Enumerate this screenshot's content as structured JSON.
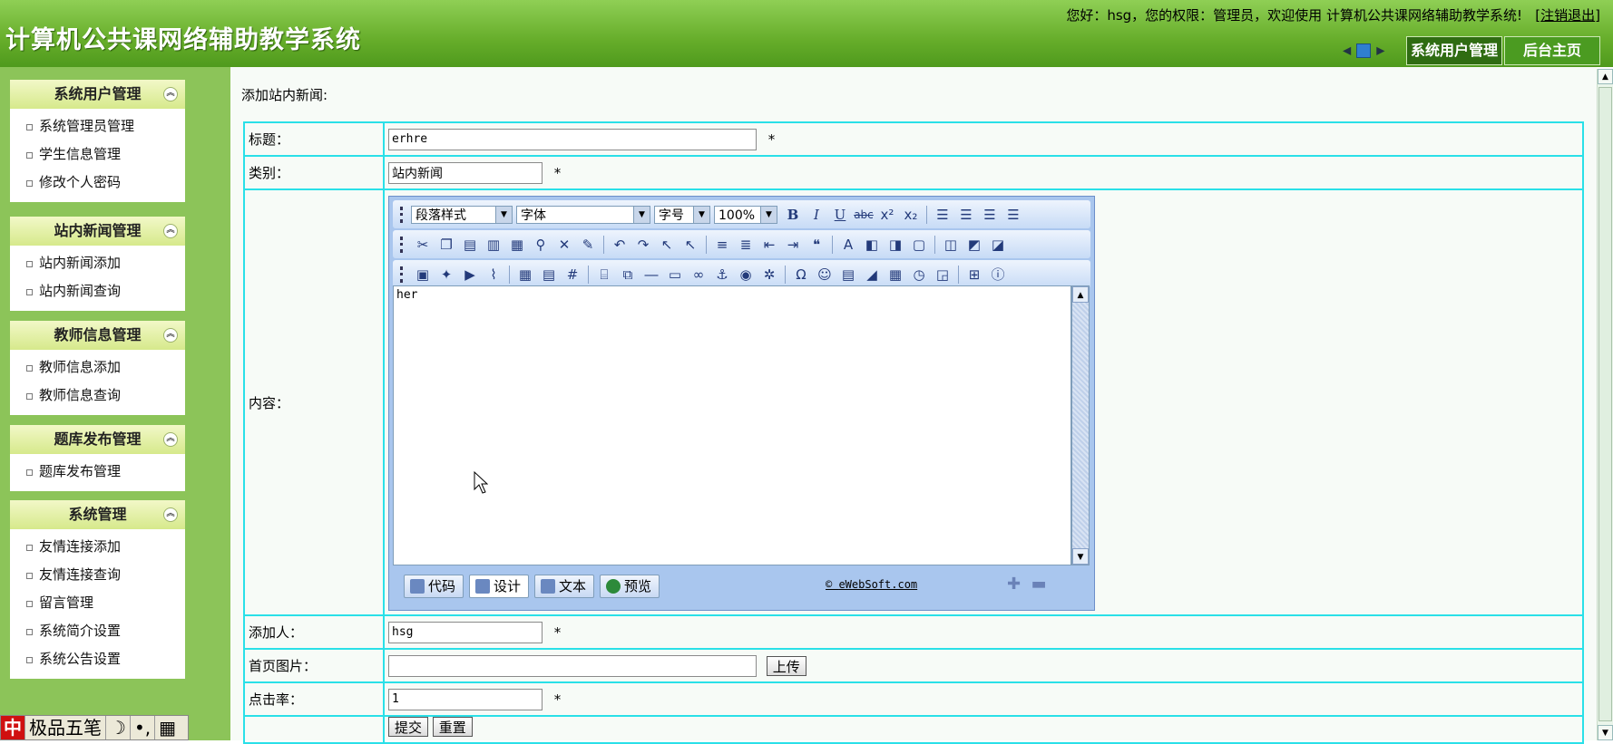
{
  "header": {
    "app_title": "计算机公共课网络辅助教学系统",
    "welcome_text": "您好：hsg，您的权限：管理员，欢迎使用 计算机公共课网络辅助教学系统!",
    "logout_label": "注销退出",
    "tabs": [
      {
        "label": "系统用户管理"
      },
      {
        "label": "后台主页"
      }
    ]
  },
  "sidebar": {
    "panels": [
      {
        "title": "系统用户管理",
        "items": [
          "系统管理员管理",
          "学生信息管理",
          "修改个人密码"
        ]
      },
      {
        "title": "站内新闻管理",
        "items": [
          "站内新闻添加",
          "站内新闻查询"
        ]
      },
      {
        "title": "教师信息管理",
        "items": [
          "教师信息添加",
          "教师信息查询"
        ]
      },
      {
        "title": "题库发布管理",
        "items": [
          "题库发布管理"
        ]
      },
      {
        "title": "系统管理",
        "items": [
          "友情连接添加",
          "友情连接查询",
          "留言管理",
          "系统简介设置",
          "系统公告设置"
        ]
      }
    ],
    "ime": {
      "mode": "中",
      "name": "极品五笔",
      "moon": "☽",
      "punct": "•,"
    }
  },
  "main": {
    "heading": "添加站内新闻:",
    "required_mark": "*",
    "fields": {
      "title": {
        "label": "标题：",
        "value": "erhre"
      },
      "category": {
        "label": "类别：",
        "value": "站内新闻"
      },
      "content": {
        "label": "内容："
      },
      "author": {
        "label": "添加人：",
        "value": "hsg"
      },
      "image": {
        "label": "首页图片：",
        "value": "",
        "upload_label": "上传"
      },
      "hits": {
        "label": "点击率：",
        "value": "1"
      }
    },
    "submit_label": "提交",
    "reset_label": "重置"
  },
  "editor": {
    "paragraph_style": "段落样式",
    "font": "字体",
    "font_size": "字号",
    "zoom": "100%",
    "content_text": "her",
    "modes": [
      {
        "label": "代码",
        "icon": "code-icon"
      },
      {
        "label": "设计",
        "icon": "design-icon"
      },
      {
        "label": "文本",
        "icon": "text-icon"
      },
      {
        "label": "预览",
        "icon": "preview-icon"
      }
    ],
    "brand": "eWebSoft.com"
  }
}
